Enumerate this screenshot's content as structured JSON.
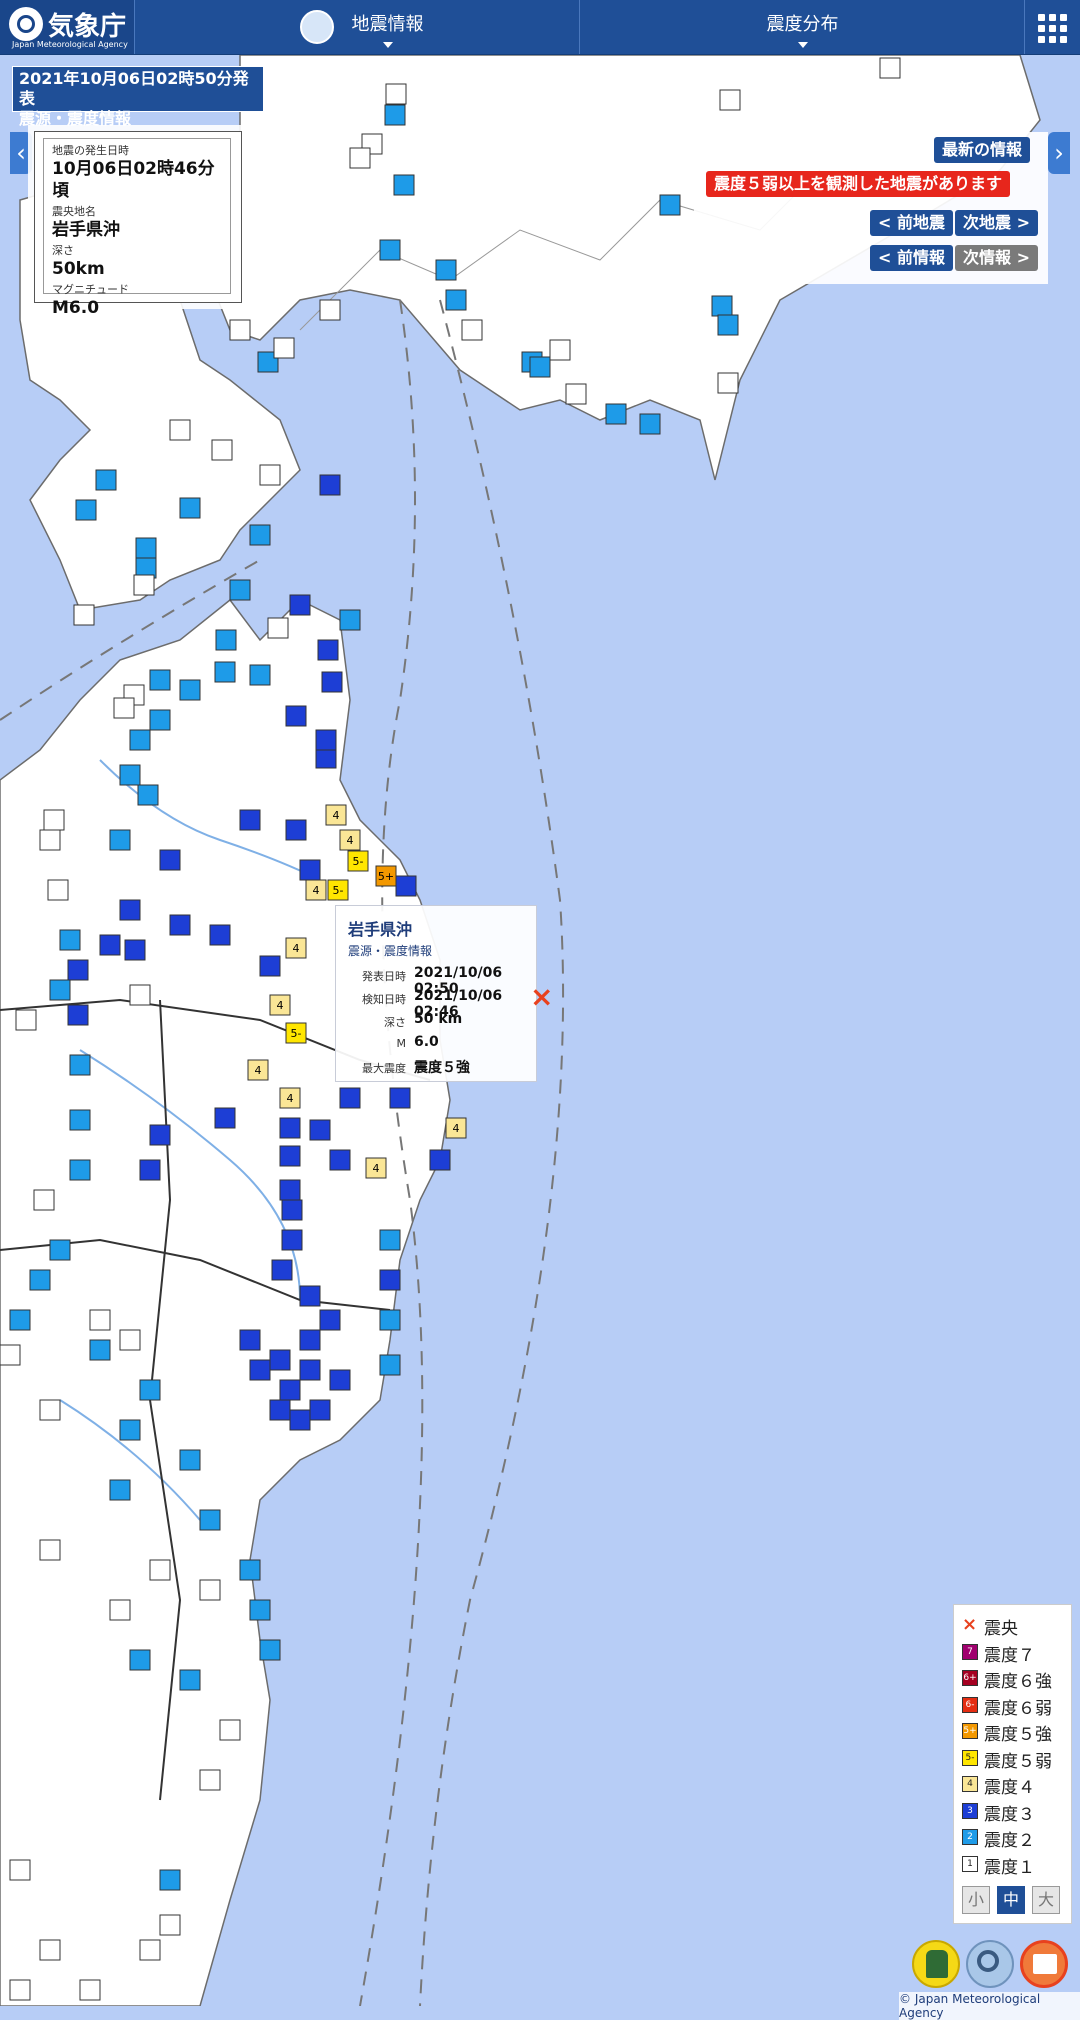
{
  "header": {
    "logo_jp": "気象庁",
    "logo_en": "Japan Meteorological Agency",
    "tab_quake": "地震情報",
    "tab_intensity": "震度分布"
  },
  "issue": {
    "line1": "2021年10月06日02時50分発表",
    "line2": "震源・震度情報"
  },
  "info": {
    "time_label": "地震の発生日時",
    "time_value": "10月06日02時46分頃",
    "place_label": "震央地名",
    "place_value": "岩手県沖",
    "depth_label": "深さ",
    "depth_value": "50km",
    "mag_label": "マグニチュード",
    "mag_value": "M6.0"
  },
  "panel": {
    "latest": "最新の情報",
    "alert": "震度５弱以上を観測した地震があります",
    "prev_quake": "< 前地震",
    "next_quake": "次地震 >",
    "prev_info": "< 前情報",
    "next_info": "次情報 >"
  },
  "popup": {
    "title": "岩手県沖",
    "subtitle": "震源・震度情報",
    "published_label": "発表日時",
    "published_value": "2021/10/06 02:50",
    "detected_label": "検知日時",
    "detected_value": "2021/10/06 02:46",
    "depth_label": "深さ",
    "depth_value": "50 km",
    "mag_label": "M",
    "mag_value": "6.0",
    "max_label": "最大震度",
    "max_value": "震度５強"
  },
  "epicenter_mark": "×",
  "legend": {
    "items": [
      {
        "code": "×",
        "label": "震央",
        "color": "#e8411e"
      },
      {
        "code": "7",
        "label": "震度７",
        "color": "#a0006e"
      },
      {
        "code": "6+",
        "label": "震度６強",
        "color": "#a50021"
      },
      {
        "code": "6-",
        "label": "震度６弱",
        "color": "#e52d12"
      },
      {
        "code": "5+",
        "label": "震度５強",
        "color": "#f39800"
      },
      {
        "code": "5-",
        "label": "震度５弱",
        "color": "#ffe600"
      },
      {
        "code": "4",
        "label": "震度４",
        "color": "#fae696"
      },
      {
        "code": "3",
        "label": "震度３",
        "color": "#1d3ed5"
      },
      {
        "code": "2",
        "label": "震度２",
        "color": "#1e9be8"
      },
      {
        "code": "1",
        "label": "震度１",
        "color": "#ffffff"
      }
    ]
  },
  "sizes": {
    "small": "小",
    "medium": "中",
    "large": "大"
  },
  "copyright": "© Japan Meteorological Agency",
  "colors": {
    "sea": "#b7cdf6",
    "land": "#ffffff",
    "header": "#1f4f97",
    "alert": "#e7261c"
  }
}
